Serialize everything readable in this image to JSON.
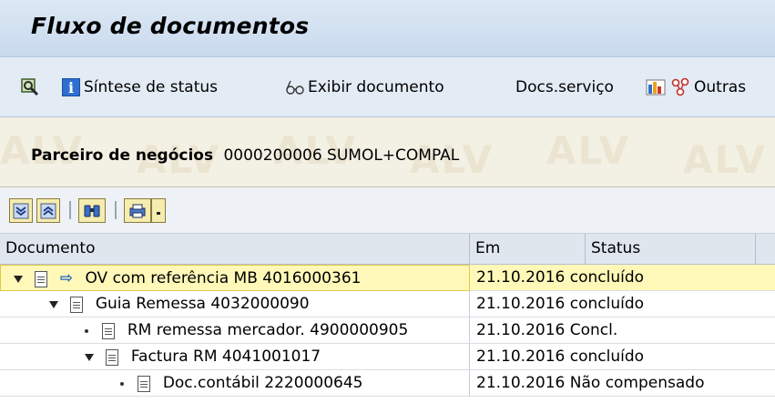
{
  "window": {
    "title": "Fluxo de documentos"
  },
  "toolbar": {
    "status_synopsis": "Síntese de status",
    "show_document": "Exibir documento",
    "service_docs": "Docs.serviço",
    "other": "Outras"
  },
  "header": {
    "partner_label": "Parceiro de negócios",
    "partner_value": "0000200006 SUMOL+COMPAL",
    "watermark": "ALV"
  },
  "grid": {
    "columns": [
      "Documento",
      "Em",
      "Status"
    ],
    "rows": [
      {
        "level": 0,
        "marker": "expanded",
        "arrow": true,
        "document": "OV com referência MB 4016000361",
        "date": "21.10.2016",
        "status": "concluído"
      },
      {
        "level": 1,
        "marker": "expanded",
        "arrow": false,
        "document": "Guia Remessa 4032000090",
        "date": "21.10.2016",
        "status": "concluído"
      },
      {
        "level": 2,
        "marker": "leaf",
        "arrow": false,
        "document": "RM remessa mercador. 4900000905",
        "date": "21.10.2016",
        "status": "Concl."
      },
      {
        "level": 2,
        "marker": "expanded",
        "arrow": false,
        "document": "Factura RM 4041001017",
        "date": "21.10.2016",
        "status": "concluído"
      },
      {
        "level": 3,
        "marker": "leaf",
        "arrow": false,
        "document": "Doc.contábil 2220000645",
        "date": "21.10.2016",
        "status": "Não compensado"
      }
    ]
  },
  "colors": {
    "highlight_row": "#fff8b8",
    "header_bg": "#dfe6ee",
    "title_bg": "#c9daee"
  },
  "icons": [
    "find-icon",
    "info-icon",
    "glasses-icon",
    "report-icon",
    "network-icon",
    "expand-all-icon",
    "collapse-all-icon",
    "binoculars-icon",
    "print-icon",
    "dropdown-icon"
  ]
}
